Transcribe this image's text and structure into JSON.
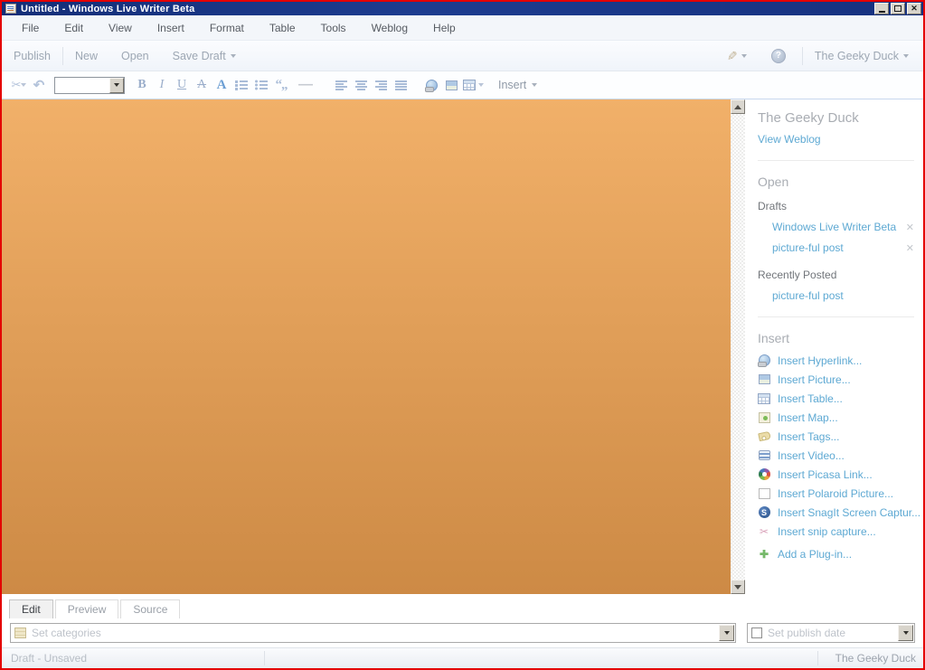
{
  "window": {
    "title": "Untitled - Windows Live Writer Beta"
  },
  "icons": {
    "cut": "✂",
    "undo": "↶",
    "pen": "✎",
    "help": "?",
    "quotes": "“„",
    "dash": "—",
    "close": "✕",
    "snagit_s": "S",
    "snip_scissors": "✂",
    "plugin_plus": "✚"
  },
  "menu": {
    "items": [
      "File",
      "Edit",
      "View",
      "Insert",
      "Format",
      "Table",
      "Tools",
      "Weblog",
      "Help"
    ]
  },
  "command_bar": {
    "publish": "Publish",
    "new": "New",
    "open": "Open",
    "save_draft": "Save Draft",
    "account": "The Geeky Duck"
  },
  "format_bar": {
    "bold": "B",
    "italic": "I",
    "underline": "U",
    "strikethrough": "A",
    "font_color": "A",
    "insert_menu": "Insert"
  },
  "sidebar": {
    "blog_title": "The Geeky Duck",
    "view_weblog": "View Weblog",
    "open_header": "Open",
    "drafts_header": "Drafts",
    "drafts": [
      {
        "title": "Windows Live Writer Beta"
      },
      {
        "title": "picture-ful post"
      }
    ],
    "recently_posted_header": "Recently Posted",
    "recent_posts": [
      "picture-ful post"
    ],
    "insert_header": "Insert",
    "insert_items": [
      {
        "label": "Insert Hyperlink...",
        "icon": "hyperlink-icon"
      },
      {
        "label": "Insert Picture...",
        "icon": "picture-icon"
      },
      {
        "label": "Insert Table...",
        "icon": "table-icon"
      },
      {
        "label": "Insert Map...",
        "icon": "map-icon"
      },
      {
        "label": "Insert Tags...",
        "icon": "tags-icon"
      },
      {
        "label": "Insert Video...",
        "icon": "video-icon"
      },
      {
        "label": "Insert Picasa Link...",
        "icon": "picasa-icon"
      },
      {
        "label": "Insert Polaroid Picture...",
        "icon": "polaroid-icon"
      },
      {
        "label": "Insert SnagIt Screen Captur...",
        "icon": "snagit-icon"
      },
      {
        "label": "Insert snip capture...",
        "icon": "snip-icon"
      },
      {
        "label": "Add a Plug-in...",
        "icon": "plus-icon"
      }
    ]
  },
  "tabs": {
    "items": [
      "Edit",
      "Preview",
      "Source"
    ],
    "active": "Edit"
  },
  "bottom_bar": {
    "categories_placeholder": "Set categories",
    "publish_date_placeholder": "Set publish date"
  },
  "status_bar": {
    "left": "Draft - Unsaved",
    "right": "The Geeky Duck"
  },
  "colors": {
    "titlebar": "#16317F",
    "window_border": "#E40000",
    "editor_top": "#F1B069",
    "editor_bottom": "#CD8A45",
    "link": "#5EA9D3",
    "muted_header": "#A9ADB3"
  }
}
